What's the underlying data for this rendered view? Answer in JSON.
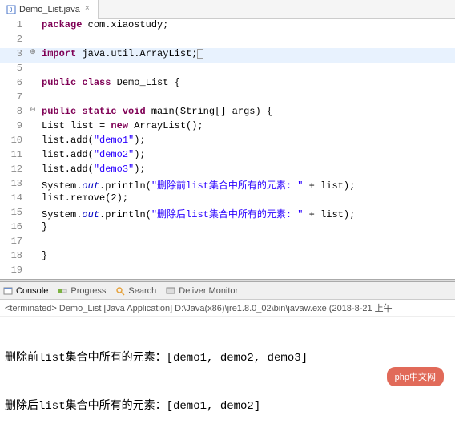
{
  "tab": {
    "filename": "Demo_List.java"
  },
  "code": {
    "lines": [
      {
        "n": "1",
        "fold": "",
        "hl": false,
        "html": "<span class='kw'>package</span> com.xiaostudy;"
      },
      {
        "n": "2",
        "fold": "",
        "hl": false,
        "html": ""
      },
      {
        "n": "3",
        "fold": "⊕",
        "hl": true,
        "html": "<span class='kw'>import</span> java.util.ArrayList;<span class='cursor-box'></span>"
      },
      {
        "n": "5",
        "fold": "",
        "hl": false,
        "html": ""
      },
      {
        "n": "6",
        "fold": "",
        "hl": false,
        "html": "<span class='kw'>public</span> <span class='kw'>class</span> Demo_List {"
      },
      {
        "n": "7",
        "fold": "",
        "hl": false,
        "html": ""
      },
      {
        "n": "8",
        "fold": "⊖",
        "hl": false,
        "html": "    <span class='kw'>public</span> <span class='kw'>static</span> <span class='kw'>void</span> main(String[] args) {"
      },
      {
        "n": "9",
        "fold": "",
        "hl": false,
        "html": "        List list = <span class='kw'>new</span> ArrayList();"
      },
      {
        "n": "10",
        "fold": "",
        "hl": false,
        "html": "        list.add(<span class='str'>\"demo1\"</span>);"
      },
      {
        "n": "11",
        "fold": "",
        "hl": false,
        "html": "        list.add(<span class='str'>\"demo2\"</span>);"
      },
      {
        "n": "12",
        "fold": "",
        "hl": false,
        "html": "        list.add(<span class='str'>\"demo3\"</span>);"
      },
      {
        "n": "13",
        "fold": "",
        "hl": false,
        "html": "        System.<span class='field'>out</span>.println(<span class='str'>\"删除前list集合中所有的元素: \"</span> + list);"
      },
      {
        "n": "14",
        "fold": "",
        "hl": false,
        "html": "        list.remove(2);"
      },
      {
        "n": "15",
        "fold": "",
        "hl": false,
        "html": "        System.<span class='field'>out</span>.println(<span class='str'>\"删除后list集合中所有的元素: \"</span> + list);"
      },
      {
        "n": "16",
        "fold": "",
        "hl": false,
        "html": "    }"
      },
      {
        "n": "17",
        "fold": "",
        "hl": false,
        "html": ""
      },
      {
        "n": "18",
        "fold": "",
        "hl": false,
        "html": "}"
      },
      {
        "n": "19",
        "fold": "",
        "hl": false,
        "html": ""
      }
    ]
  },
  "console": {
    "tabs": {
      "console": "Console",
      "progress": "Progress",
      "search": "Search",
      "deliver": "Deliver Monitor"
    },
    "status": "<terminated> Demo_List [Java Application] D:\\Java(x86)\\jre1.8.0_02\\bin\\javaw.exe (2018-8-21 上午",
    "out_line1": "删除前list集合中所有的元素：[demo1, demo2, demo3]",
    "out_line2": "删除后list集合中所有的元素：[demo1, demo2]"
  },
  "watermark": "php中文网"
}
